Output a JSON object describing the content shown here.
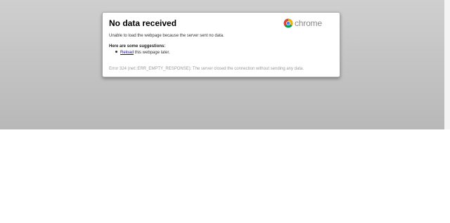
{
  "error_page": {
    "title": "No data received",
    "summary": "Unable to load the webpage because the server sent no data.",
    "suggestions_heading": "Here are some suggestions:",
    "suggestions": [
      {
        "link_text": "Reload",
        "rest": " this webpage later."
      }
    ],
    "error_code": "Error 324 (net::ERR_EMPTY_RESPONSE): The server closed the connection without sending any data."
  },
  "brand": {
    "name": "chrome",
    "icon": "chrome-logo-icon"
  },
  "colors": {
    "backdrop_top": "#cfcfcf",
    "backdrop_bottom": "#b8b8b8",
    "link": "#1a0dab",
    "muted_text": "#9a9a9a"
  }
}
